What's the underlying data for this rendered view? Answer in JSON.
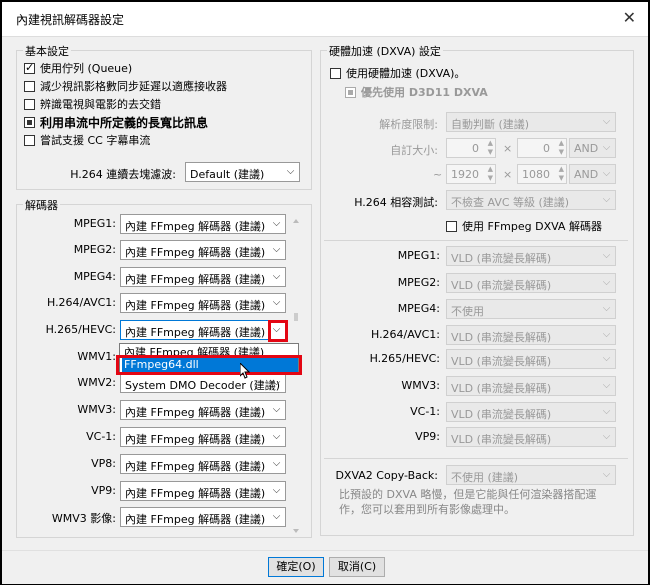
{
  "window": {
    "title": "內建視訊解碼器設定"
  },
  "basic": {
    "title": "基本設定",
    "options": [
      {
        "label": "使用佇列 (Queue)",
        "checked": true
      },
      {
        "label": "減少視訊影格數同步延遲以適應接收器",
        "checked": false
      },
      {
        "label": "辨識電視與電影的去交錯",
        "checked": false
      },
      {
        "label": "利用串流中所定義的長寬比訊息",
        "checked": "partial"
      },
      {
        "label": "嘗試支援 CC 字幕串流",
        "checked": false
      }
    ],
    "deblock_label": "H.264 連續去塊濾波:",
    "deblock_value": "Default (建議)"
  },
  "decoders": {
    "title": "解碼器",
    "rows": [
      {
        "label": "MPEG1:",
        "value": "內建 FFmpeg 解碼器 (建議)"
      },
      {
        "label": "MPEG2:",
        "value": "內建 FFmpeg 解碼器 (建議)"
      },
      {
        "label": "MPEG4:",
        "value": "內建 FFmpeg 解碼器 (建議)"
      },
      {
        "label": "H.264/AVC1:",
        "value": "內建 FFmpeg 解碼器 (建議)"
      },
      {
        "label": "H.265/HEVC:",
        "value": "內建 FFmpeg 解碼器 (建議)"
      },
      {
        "label": "WMV1:",
        "value": "內建 FFmpeg 解碼器 (建議)"
      },
      {
        "label": "WMV2:",
        "value": "System DMO Decoder (建議)"
      },
      {
        "label": "WMV3:",
        "value": "內建 FFmpeg 解碼器 (建議)"
      },
      {
        "label": "VC-1:",
        "value": "內建 FFmpeg 解碼器 (建議)"
      },
      {
        "label": "VP8:",
        "value": "內建 FFmpeg 解碼器 (建議)"
      },
      {
        "label": "VP9:",
        "value": "內建 FFmpeg 解碼器 (建議)"
      },
      {
        "label": "WMV3 影像:",
        "value": "內建 FFmpeg 解碼器 (建議)"
      }
    ],
    "dropdown_options": [
      "內建 FFmpeg 解碼器 (建議)",
      "FFmpeg64.dll"
    ]
  },
  "hw": {
    "title": "硬體加速 (DXVA) 設定",
    "use_hw_label": "使用硬體加速 (DXVA)。",
    "prefer_d3d11_label": "優先使用 D3D11 DXVA",
    "resolution_label": "解析度限制:",
    "resolution_value": "自動判斷 (建議)",
    "custom_size_label": "自訂大小:",
    "w1": "0",
    "h1": "0",
    "and1": "AND",
    "tilde": "~",
    "w2": "1920",
    "h2": "1080",
    "and2": "AND",
    "times": "×",
    "h264_compat_label": "H.264 相容測試:",
    "h264_compat_value": "不檢查 AVC 等級 (建議)",
    "ffmpeg_dxva_label": "使用 FFmpeg DXVA 解碼器",
    "rows": [
      {
        "label": "MPEG1:",
        "value": "VLD (串流變長解碼)"
      },
      {
        "label": "MPEG2:",
        "value": "VLD (串流變長解碼)"
      },
      {
        "label": "MPEG4:",
        "value": "不使用"
      },
      {
        "label": "H.264/AVC1:",
        "value": "VLD (串流變長解碼)"
      },
      {
        "label": "H.265/HEVC:",
        "value": "VLD (串流變長解碼)"
      },
      {
        "label": "WMV3:",
        "value": "VLD (串流變長解碼)"
      },
      {
        "label": "VC-1:",
        "value": "VLD (串流變長解碼)"
      },
      {
        "label": "VP9:",
        "value": "VLD (串流變長解碼)"
      }
    ],
    "copyback_label": "DXVA2 Copy-Back:",
    "copyback_value": "不使用 (建議)",
    "hint_line1": "比預設的 DXVA 略慢，但是它能與任何渲染器搭配運",
    "hint_line2": "作，您可以套用到所有影像處理中。"
  },
  "buttons": {
    "ok": "確定(O)",
    "cancel": "取消(C)"
  },
  "colors": {
    "accent": "#0078d7",
    "highlight_box": "#e30613"
  }
}
